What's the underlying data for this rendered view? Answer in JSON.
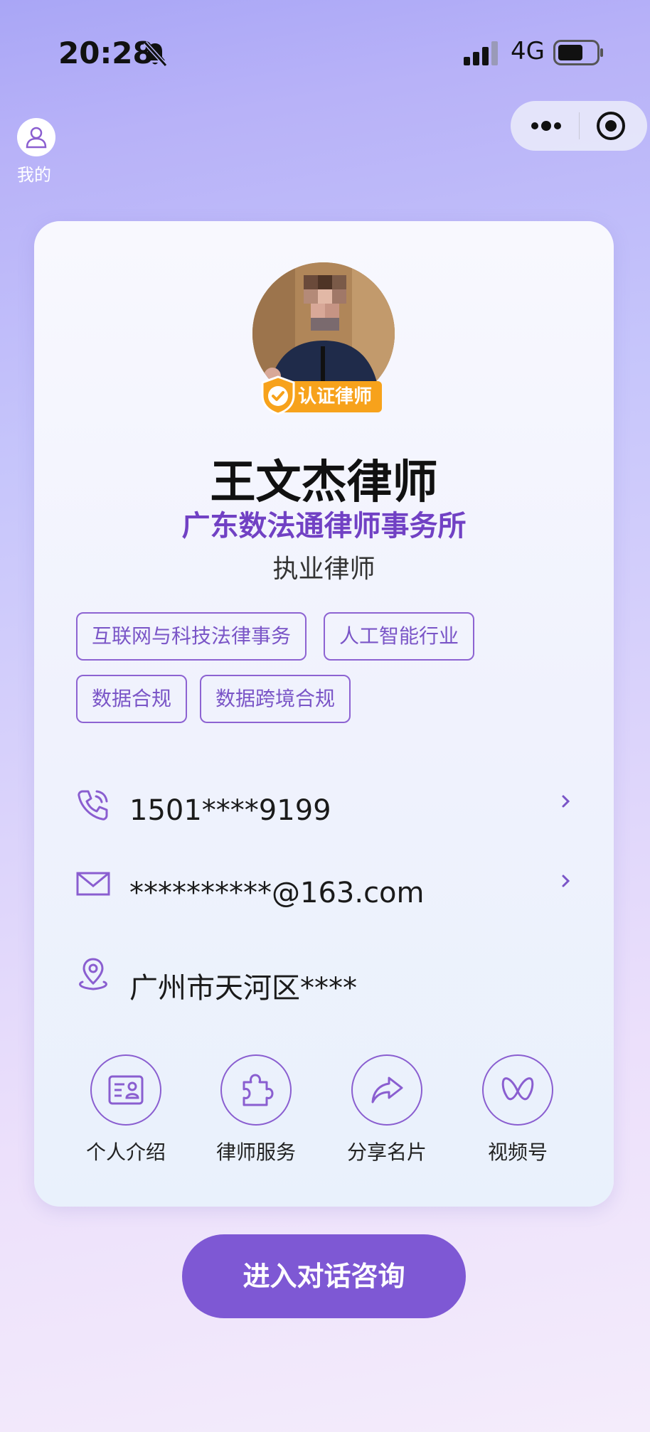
{
  "status_bar": {
    "time": "20:28",
    "network": "4G",
    "icons": [
      "bell-muted-icon",
      "signal-icon",
      "battery-icon"
    ]
  },
  "capsule": {
    "icons": [
      "more-icon",
      "target-icon"
    ]
  },
  "mine": {
    "label": "我的",
    "icon": "user-icon"
  },
  "profile": {
    "verified_label": "认证律师",
    "name": "王文杰律师",
    "firm": "广东数法通律师事务所",
    "title": "执业律师"
  },
  "tags": [
    "互联网与科技法律事务",
    "人工智能行业",
    "数据合规",
    "数据跨境合规"
  ],
  "contact": {
    "phone": "1501****9199",
    "email": "**********@163.com",
    "address": "广州市天河区****"
  },
  "actions": [
    {
      "label": "个人介绍",
      "icon": "id-card-icon"
    },
    {
      "label": "律师服务",
      "icon": "puzzle-icon"
    },
    {
      "label": "分享名片",
      "icon": "share-icon"
    },
    {
      "label": "视频号",
      "icon": "channels-icon"
    }
  ],
  "cta": {
    "label": "进入对话咨询"
  },
  "colors": {
    "accent": "#7e58d4",
    "firm": "#7141c4",
    "badge": "#f7a21b"
  }
}
